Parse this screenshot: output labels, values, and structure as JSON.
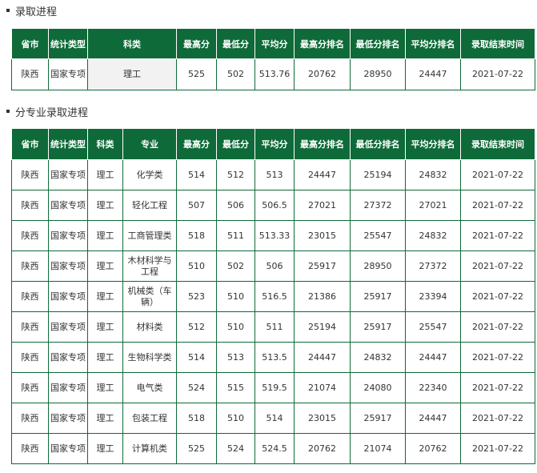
{
  "section1": {
    "title": "录取进程",
    "headers": [
      "省市",
      "统计类型",
      "科类",
      "最高分",
      "最低分",
      "平均分",
      "最高分排名",
      "最低分排名",
      "平均分排名",
      "录取结束时间"
    ],
    "rows": [
      [
        "陕西",
        "国家专项",
        "理工",
        "525",
        "502",
        "513.76",
        "20762",
        "28950",
        "24447",
        "2021-07-22"
      ]
    ]
  },
  "section2": {
    "title": "分专业录取进程",
    "headers": [
      "省市",
      "统计类型",
      "科类",
      "专业",
      "最高分",
      "最低分",
      "平均分",
      "最高分排名",
      "最低分排名",
      "平均分排名",
      "录取结束时间"
    ],
    "rows": [
      [
        "陕西",
        "国家专项",
        "理工",
        "化学类",
        "514",
        "512",
        "513",
        "24447",
        "25194",
        "24832",
        "2021-07-22"
      ],
      [
        "陕西",
        "国家专项",
        "理工",
        "轻化工程",
        "507",
        "506",
        "506.5",
        "27021",
        "27372",
        "27021",
        "2021-07-22"
      ],
      [
        "陕西",
        "国家专项",
        "理工",
        "工商管理类",
        "518",
        "511",
        "513.33",
        "23015",
        "25547",
        "24832",
        "2021-07-22"
      ],
      [
        "陕西",
        "国家专项",
        "理工",
        "木材科学与工程",
        "510",
        "502",
        "506",
        "25917",
        "28950",
        "27372",
        "2021-07-22"
      ],
      [
        "陕西",
        "国家专项",
        "理工",
        "机械类（车辆）",
        "523",
        "510",
        "516.5",
        "21386",
        "25917",
        "23394",
        "2021-07-22"
      ],
      [
        "陕西",
        "国家专项",
        "理工",
        "材料类",
        "512",
        "510",
        "511",
        "25194",
        "25917",
        "25547",
        "2021-07-22"
      ],
      [
        "陕西",
        "国家专项",
        "理工",
        "生物科学类",
        "514",
        "513",
        "513.5",
        "24447",
        "24832",
        "24447",
        "2021-07-22"
      ],
      [
        "陕西",
        "国家专项",
        "理工",
        "电气类",
        "524",
        "515",
        "519.5",
        "21074",
        "24080",
        "22340",
        "2021-07-22"
      ],
      [
        "陕西",
        "国家专项",
        "理工",
        "包装工程",
        "518",
        "510",
        "514",
        "23015",
        "25917",
        "24447",
        "2021-07-22"
      ],
      [
        "陕西",
        "国家专项",
        "理工",
        "计算机类",
        "525",
        "524",
        "524.5",
        "20762",
        "21074",
        "20762",
        "2021-07-22"
      ]
    ]
  }
}
